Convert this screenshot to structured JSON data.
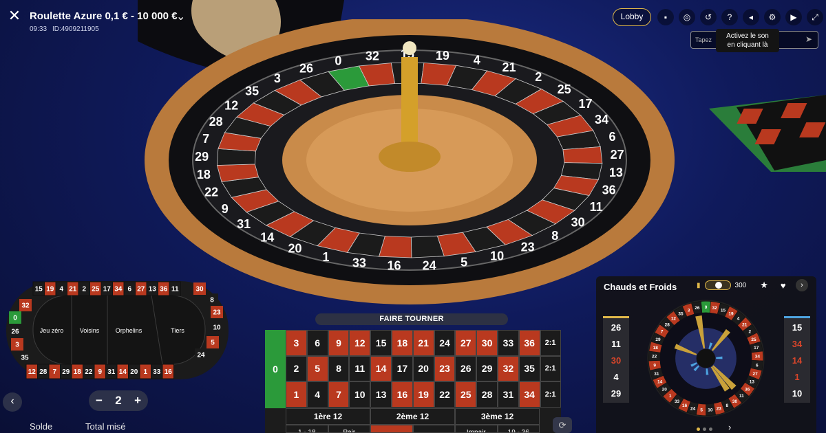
{
  "header": {
    "title": "Roulette Azure 0,1 € - 10 000 €",
    "time": "09:33",
    "id": "ID:4909211905",
    "lobby": "Lobby"
  },
  "chat": {
    "placeholder": "Tapez",
    "tooltip_line1": "Activez le son",
    "tooltip_line2": "en cliquant là"
  },
  "racetrack": {
    "top": [
      "15",
      "19",
      "4",
      "21",
      "2",
      "25",
      "17",
      "34",
      "6",
      "27",
      "13",
      "36",
      "11"
    ],
    "right_top": [
      "30",
      "8",
      "23",
      "10",
      "5",
      "24"
    ],
    "bottom": [
      "12",
      "28",
      "7",
      "29",
      "18",
      "22",
      "9",
      "31",
      "14",
      "20",
      "1",
      "33",
      "16"
    ],
    "left": [
      "32",
      "0",
      "26",
      "3",
      "35"
    ],
    "sections": [
      "Jeu zéro",
      "Voisins",
      "Orphelins",
      "Tiers"
    ]
  },
  "table": {
    "spin_label": "FAIRE TOURNER",
    "zero": "0",
    "rows": [
      [
        "3",
        "6",
        "9",
        "12",
        "15",
        "18",
        "21",
        "24",
        "27",
        "30",
        "33",
        "36",
        "2:1"
      ],
      [
        "2",
        "5",
        "8",
        "11",
        "14",
        "17",
        "20",
        "23",
        "26",
        "29",
        "32",
        "35",
        "2:1"
      ],
      [
        "1",
        "4",
        "7",
        "10",
        "13",
        "16",
        "19",
        "22",
        "25",
        "28",
        "31",
        "34",
        "2:1"
      ]
    ],
    "dozens": [
      "1ère 12",
      "2ème 12",
      "3ème 12"
    ],
    "outside": [
      "1 - 18",
      "Pair",
      "",
      "",
      "Impair",
      "19 - 36"
    ]
  },
  "controls": {
    "chip_value": "2",
    "minus": "−",
    "plus": "+",
    "balance_label": "Solde",
    "total_label": "Total misé"
  },
  "hot_cold": {
    "title": "Chauds et Froids",
    "rounds": "300",
    "hot": [
      "26",
      "11",
      "30",
      "4",
      "29"
    ],
    "cold": [
      "15",
      "34",
      "14",
      "1",
      "10"
    ]
  },
  "wheel_numbers": [
    "0",
    "32",
    "15",
    "19",
    "4",
    "21",
    "2",
    "25",
    "17",
    "34",
    "6",
    "27",
    "13",
    "36",
    "11",
    "30",
    "8",
    "23",
    "10",
    "5",
    "24",
    "16",
    "33",
    "1",
    "20",
    "14",
    "31",
    "9",
    "22",
    "18",
    "29",
    "7",
    "28",
    "12",
    "35",
    "3",
    "26"
  ],
  "colors": {
    "red": "#b9391f",
    "black": "#1b1b1b",
    "green": "#2b9a3a",
    "accent": "#e0b84a",
    "cold": "#4da3e0"
  }
}
